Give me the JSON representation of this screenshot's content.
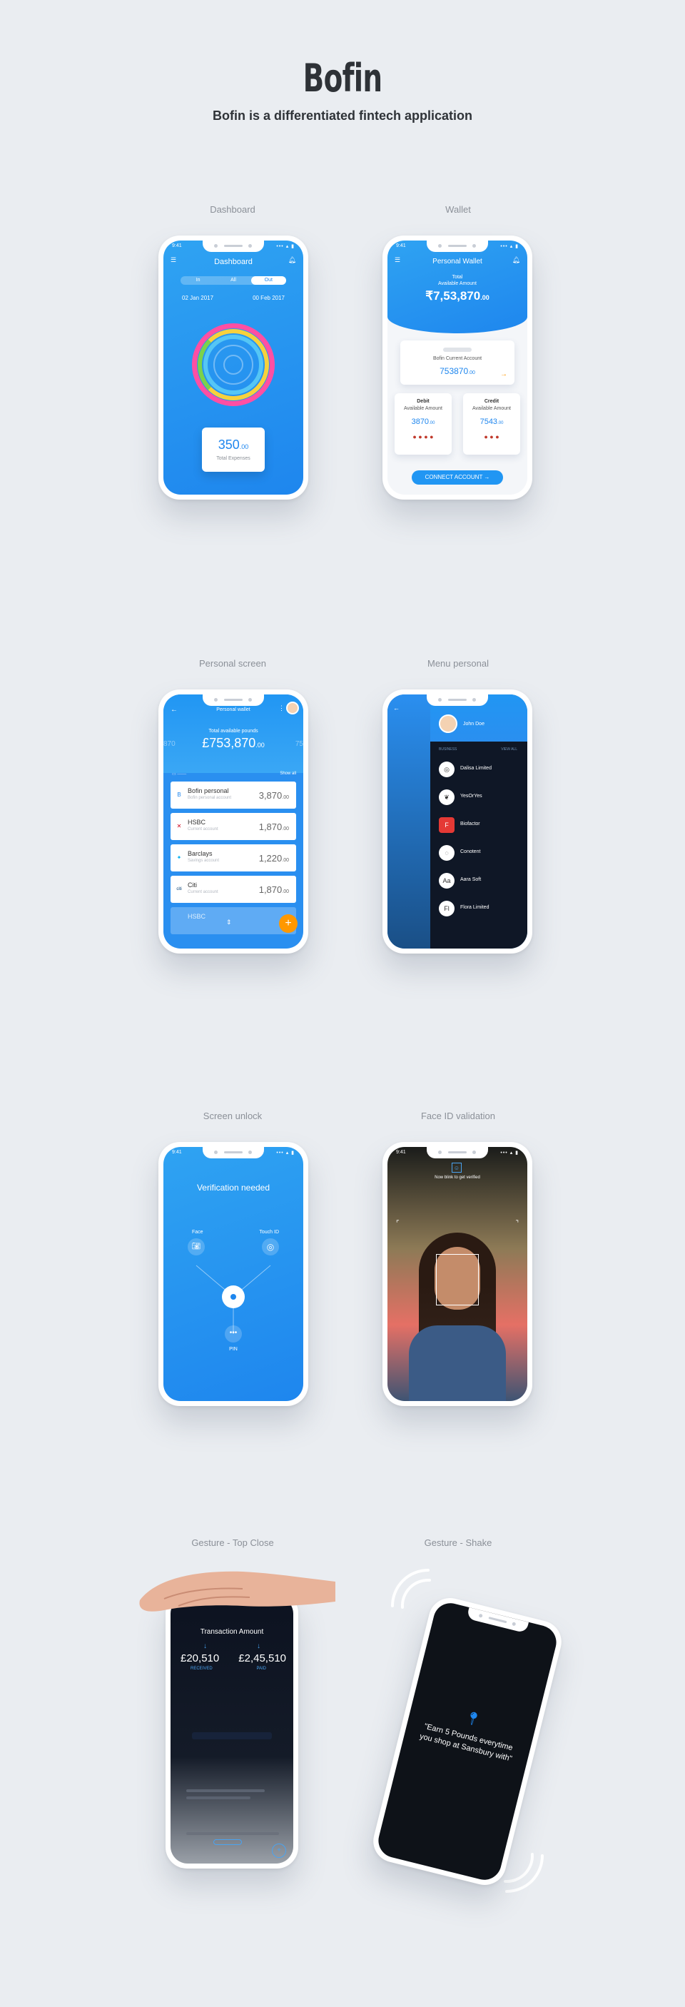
{
  "title": "Bofin",
  "tagline": "Bofin is a differentiated fintech application",
  "captions": {
    "dashboard": "Dashboard",
    "wallet": "Wallet",
    "personal": "Personal screen",
    "menu": "Menu personal",
    "unlock": "Screen unlock",
    "faceid": "Face ID validation",
    "gesture_top": "Gesture - Top Close",
    "gesture_shake": "Gesture - Shake"
  },
  "status": {
    "time": "9:41",
    "signal": "••• ▴ ▮"
  },
  "dashboard": {
    "title": "Dashboard",
    "tabs": [
      "In",
      "All",
      "Out"
    ],
    "from_date": "02 Jan 2017",
    "to_date": "00 Feb 2017",
    "amount": "350",
    "amount_dec": ".00",
    "amount_label": "Total Expenses"
  },
  "wallet": {
    "title": "Personal Wallet",
    "total_label": "Total",
    "available_label": "Available Amount",
    "total": "7,53,870",
    "total_dec": ".00",
    "account_label": "Bofin Current Account",
    "account_amount": "753870",
    "account_dec": ".00",
    "debit": {
      "title": "Debit",
      "label": "Available Amount",
      "amount": "3870",
      "dec": ".00"
    },
    "credit": {
      "title": "Credit",
      "label": "Available Amount",
      "amount": "7543",
      "dec": ".00"
    },
    "connect": "CONNECT ACCOUNT →"
  },
  "personal": {
    "title": "Personal wallet",
    "total_label": "Total available pounds",
    "total": "753,870",
    "total_dec": ".00",
    "left_peek": "870",
    "right_peek": "75",
    "show_all": "Show all",
    "rows": [
      {
        "name": "Bofin personal",
        "sub": "Bofin personal account",
        "amount": "3,870",
        "dec": ".00",
        "logo": "B"
      },
      {
        "name": "HSBC",
        "sub": "Current account",
        "amount": "1,870",
        "dec": ".00",
        "logo": "✕"
      },
      {
        "name": "Barclays",
        "sub": "Savings account",
        "amount": "1,220",
        "dec": ".00",
        "logo": "✦"
      },
      {
        "name": "Citi",
        "sub": "Current account",
        "amount": "1,870",
        "dec": ".00",
        "logo": "citi"
      }
    ],
    "bottom_peek": "HSBC",
    "fab": "+"
  },
  "menu": {
    "user": "John Doe",
    "col1": "BUSINESS",
    "col2": "VIEW ALL",
    "items": [
      {
        "label": "Dalisa Limited",
        "icon": "◎"
      },
      {
        "label": "YesOrYes",
        "icon": "❦"
      },
      {
        "label": "Biofactor",
        "icon": "F"
      },
      {
        "label": "Conotent",
        "icon": "◌"
      },
      {
        "label": "Aara Soft",
        "icon": "Aa"
      },
      {
        "label": "Flora Limited",
        "icon": "Fl"
      }
    ]
  },
  "unlock": {
    "title": "Verification needed",
    "face": "Face",
    "touch": "Touch ID",
    "pin": "PIN"
  },
  "faceid": {
    "hint": "Now blink to get verified"
  },
  "gesture_top": {
    "title": "Transaction Amount",
    "received": "20,510",
    "received_label": "RECEIVED",
    "paid": "2,45,510",
    "paid_label": "PAID"
  },
  "gesture_shake": {
    "message": "\"Earn 5 Pounds everytime you shop at Sansbury with\""
  },
  "colors": {
    "primary": "#1e86ee",
    "accent": "#ff9800",
    "dark": "#0d1117"
  }
}
